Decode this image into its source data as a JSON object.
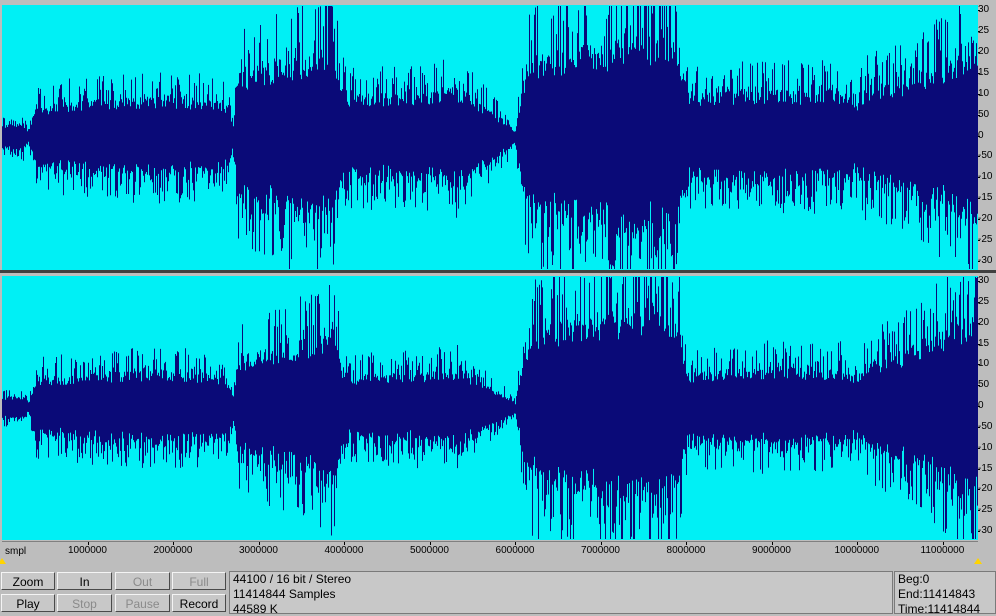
{
  "format_info": {
    "sample_rate_format": "44100 / 16 bit / Stereo",
    "samples": "11414844 Samples",
    "size": "44589 K"
  },
  "range_info": {
    "begin": "Beg:0",
    "end": "End:11414843",
    "time": "Time:11414844"
  },
  "buttons": {
    "zoom": "Zoom",
    "in": "In",
    "out": "Out",
    "full": "Full",
    "play": "Play",
    "stop": "Stop",
    "pause": "Pause",
    "record": "Record"
  },
  "ruler": {
    "unit": "smpl",
    "ticks": [
      "1000000",
      "2000000",
      "3000000",
      "4000000",
      "5000000",
      "6000000",
      "7000000",
      "8000000",
      "9000000",
      "10000000",
      "11000000"
    ]
  },
  "yaxis": {
    "labels": [
      "30",
      "25",
      "20",
      "15",
      "10",
      "50",
      "0",
      "-50",
      "-10",
      "-15",
      "-20",
      "-25",
      "-30"
    ]
  },
  "colors": {
    "background": "#00f0f5",
    "waveform": "#0a0a78"
  },
  "waveform_envelope": {
    "sample_points": [
      0,
      250000,
      300000,
      400000,
      800000,
      1300000,
      1800000,
      2300000,
      2620000,
      2700000,
      2750000,
      3000000,
      3400000,
      3800000,
      3880000,
      3950000,
      4050000,
      4500000,
      5000000,
      5300000,
      5400000,
      5900000,
      6000000,
      6100000,
      6200000,
      6500000,
      7000000,
      7500000,
      7900000,
      8000000,
      8050000,
      8500000,
      9000000,
      9500000,
      9800000,
      10000000,
      10100000,
      10500000,
      11000000,
      11414844
    ],
    "left_amplitude": [
      0.12,
      0.14,
      0.05,
      0.3,
      0.35,
      0.37,
      0.4,
      0.38,
      0.33,
      0.12,
      0.62,
      0.7,
      0.78,
      0.86,
      0.95,
      0.55,
      0.42,
      0.43,
      0.45,
      0.48,
      0.45,
      0.15,
      0.06,
      0.6,
      0.8,
      0.84,
      0.9,
      0.98,
      0.97,
      0.5,
      0.42,
      0.44,
      0.46,
      0.45,
      0.46,
      0.35,
      0.5,
      0.55,
      0.72,
      0.98
    ],
    "right_amplitude": [
      0.11,
      0.12,
      0.04,
      0.3,
      0.32,
      0.35,
      0.37,
      0.35,
      0.3,
      0.1,
      0.48,
      0.56,
      0.64,
      0.72,
      0.92,
      0.44,
      0.32,
      0.34,
      0.36,
      0.38,
      0.35,
      0.12,
      0.05,
      0.55,
      0.78,
      0.85,
      0.92,
      0.98,
      0.96,
      0.42,
      0.35,
      0.38,
      0.4,
      0.38,
      0.4,
      0.3,
      0.45,
      0.55,
      0.78,
      0.98
    ]
  }
}
